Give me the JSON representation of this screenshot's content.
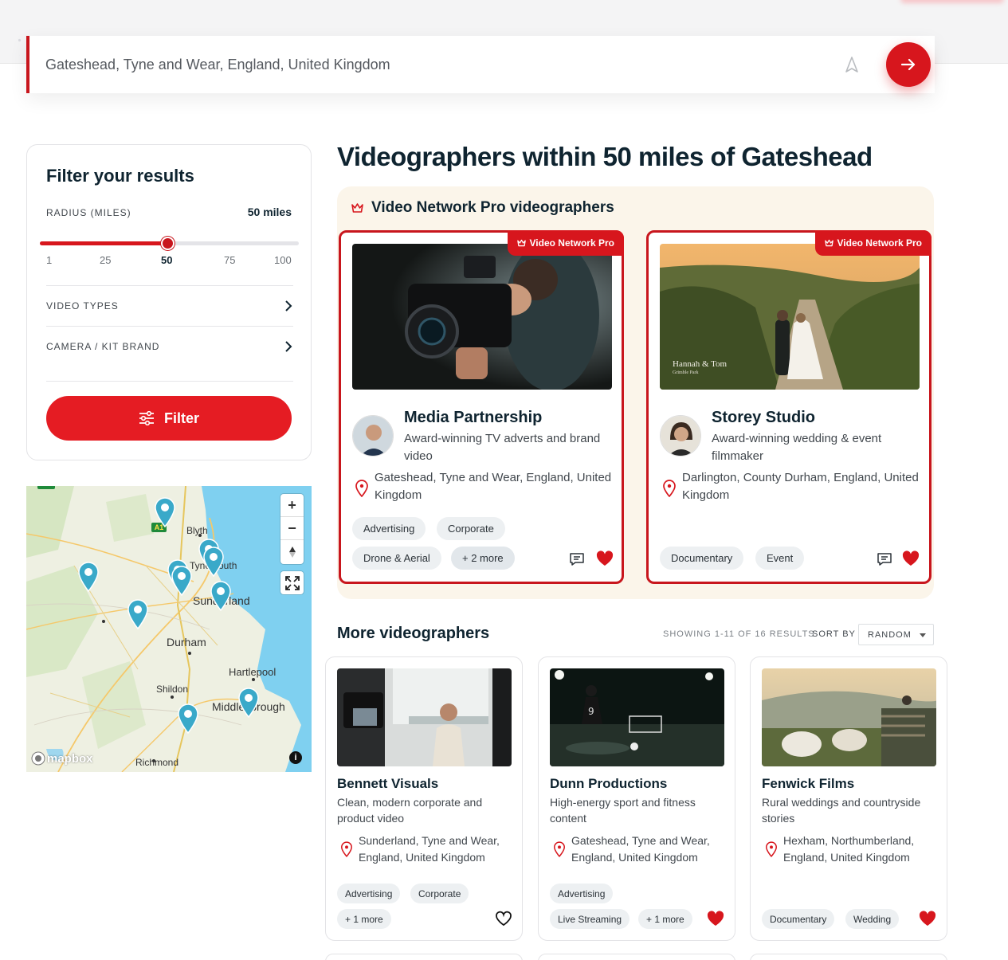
{
  "search": {
    "value": "Gateshead, Tyne and Wear, England, United Kingdom"
  },
  "filters": {
    "title": "Filter your results",
    "radius_label": "RADIUS (MILES)",
    "radius_value": "50 miles",
    "radius_level": 50,
    "ticks": [
      "1",
      "25",
      "50",
      "75",
      "100"
    ],
    "video_types_label": "VIDEO TYPES",
    "camera_label": "CAMERA / KIT BRAND",
    "filter_button": "Filter"
  },
  "map": {
    "places": [
      "Blyth",
      "Tynemouth",
      "Sunderland",
      "Durham",
      "Hartlepool",
      "Shildon",
      "Middlesbrough",
      "Richmond"
    ],
    "road_badge": "A1",
    "zoom_in": "+",
    "zoom_out": "−",
    "attribution": "mapbox",
    "info": "i"
  },
  "page_title": "Videographers within 50 miles of Gateshead",
  "pro": {
    "heading": "Video Network Pro videographers",
    "badge": "Video Network Pro",
    "cards": [
      {
        "name": "Media Partnership",
        "description": "Award-winning TV adverts and brand video",
        "location": "Gateshead, Tyne and Wear, England, United Kingdom",
        "tags": [
          "Advertising",
          "Corporate",
          "Drone & Aerial",
          "+ 2 more"
        ],
        "favourited": true
      },
      {
        "name": "Storey Studio",
        "description": "Award-winning wedding & event filmmaker",
        "location": "Darlington, County Durham, England, United Kingdom",
        "photo_caption": "Hannah & Tom",
        "photo_subcaption": "Grimble Park",
        "tags": [
          "Documentary",
          "Event"
        ],
        "favourited": true
      }
    ]
  },
  "more": {
    "title": "More videographers",
    "results": "SHOWING 1-11 OF 16 RESULTS",
    "sort_label": "SORT BY",
    "sort_value": "RANDOM",
    "cards": [
      {
        "name": "Bennett Visuals",
        "description": "Clean, modern corporate and product video",
        "location": "Sunderland, Tyne and Wear, England, United Kingdom",
        "tags": [
          "Advertising",
          "Corporate",
          "+ 1 more"
        ],
        "favourited": false
      },
      {
        "name": "Dunn Productions",
        "description": "High-energy sport and fitness content",
        "location": "Gateshead, Tyne and Wear, England, United Kingdom",
        "tags": [
          "Advertising",
          "Live Streaming",
          "+ 1 more"
        ],
        "favourited": true
      },
      {
        "name": "Fenwick Films",
        "description": "Rural weddings and countryside stories",
        "location": "Hexham, Northumberland, England, United Kingdom",
        "tags": [
          "Documentary",
          "Wedding"
        ],
        "favourited": true
      }
    ]
  },
  "colors": {
    "accent": "#d7161d",
    "heading": "#0f2430",
    "pro_panel": "#fbf5ea",
    "map_pin": "#3aa9c9",
    "sea": "#7fd0f0"
  },
  "icons": [
    "locate-arrow-icon",
    "arrow-right-icon",
    "chevron-right-icon",
    "sliders-icon",
    "crown-icon",
    "map-pin-icon",
    "message-icon",
    "heart-icon",
    "fullscreen-icon",
    "compass-icon"
  ]
}
